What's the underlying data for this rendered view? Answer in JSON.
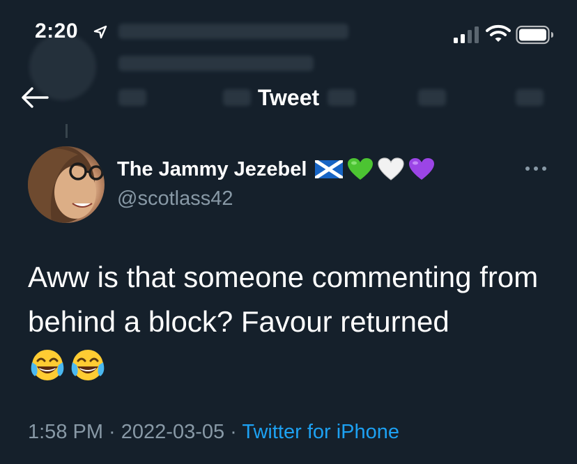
{
  "status_bar": {
    "time": "2:20",
    "location_icon": "location-arrow-icon",
    "signal_icon": "cellular-signal-icon",
    "wifi_icon": "wifi-icon",
    "battery_icon": "battery-icon"
  },
  "header": {
    "back_icon": "back-arrow-icon",
    "title": "Tweet"
  },
  "tweet": {
    "author": {
      "name": "The Jammy Jezebel",
      "name_emojis": [
        "scotland-flag-icon",
        "green-heart-icon",
        "white-heart-icon",
        "purple-heart-icon"
      ],
      "handle": "@scotlass42"
    },
    "text": "Aww is that someone commenting from behind a block? Favour returned",
    "text_emojis": [
      "face-with-tears-of-joy-icon",
      "face-with-tears-of-joy-icon"
    ],
    "time": "1:58 PM",
    "separator": " · ",
    "date": "2022-03-05",
    "source": "Twitter for iPhone"
  },
  "colors": {
    "background": "#15202b",
    "secondary_text": "#8899a6",
    "link": "#1da1f2"
  }
}
